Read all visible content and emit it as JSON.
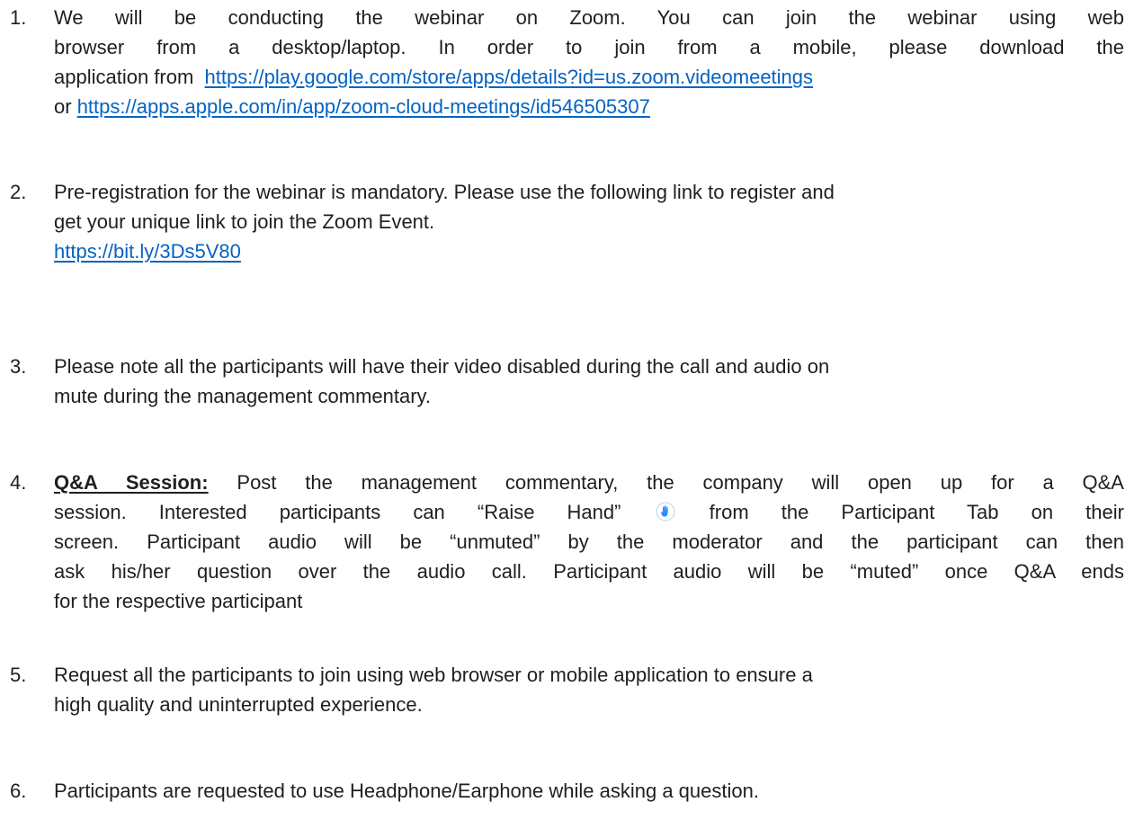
{
  "items": [
    {
      "number": "1.",
      "lines": [
        "We will be conducting the webinar on Zoom. You can join the webinar using web",
        "browser from a desktop/laptop. In order to join from a mobile, please download the",
        "application from"
      ],
      "link_play": "https://play.google.com/store/apps/details?id=us.zoom.videomeetings",
      "or_text": "or",
      "link_apple": "https://apps.apple.com/in/app/zoom-cloud-meetings/id546505307"
    },
    {
      "number": "2.",
      "lines": [
        "Pre-registration for the webinar is mandatory. Please use the following link to register and",
        "get your unique link to join the Zoom Event."
      ],
      "link": "https://bit.ly/3Ds5V80"
    },
    {
      "number": "3.",
      "lines": [
        "Please note all the participants will have their video disabled during the call and audio on",
        "mute during the management commentary."
      ]
    },
    {
      "number": "4.",
      "bold_label": "Q&A Session:",
      "line1_rest": "Post the management commentary, the company will open up for a Q&A",
      "line2_before_icon": "session. Interested participants can “Raise Hand”",
      "line2_after_icon": "from the Participant Tab on their",
      "lines_rest": [
        "screen. Participant audio will be “unmuted” by the moderator and the participant can then",
        "ask his/her question over the audio call. Participant audio will be “muted” once Q&A ends",
        "for the respective participant"
      ],
      "icon": "raise-hand-icon"
    },
    {
      "number": "5.",
      "lines": [
        "Request all the participants to join using web browser or mobile application to ensure a",
        "high quality and uninterrupted experience."
      ]
    },
    {
      "number": "6.",
      "lines": [
        "Participants are requested to use Headphone/Earphone while asking a question."
      ]
    }
  ],
  "colors": {
    "text": "#1f1f1f",
    "link": "#0563c1",
    "icon_blue": "#2d8cff"
  }
}
